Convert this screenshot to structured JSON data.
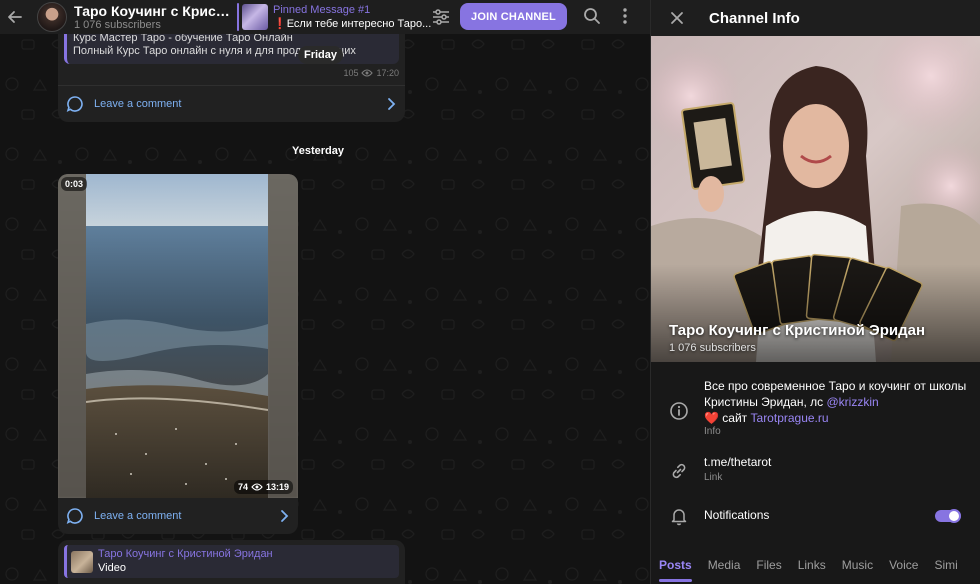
{
  "header": {
    "back_label": "←",
    "channel_title": "Таро Коучинг с Кристи...",
    "subscribers": "1 076 subscribers",
    "pinned_title": "Pinned Message #1",
    "pinned_text": "Если тебе интересно Таро...",
    "pinned_mark": "❗",
    "join_label": "JOIN CHANNEL"
  },
  "messages": {
    "msg1": {
      "reply_line1": "Курс Мастер Таро - обучение Таро Онлайн",
      "reply_line2": "Полный Курс Таро онлайн с нуля и для продолжающих",
      "views": "105",
      "time": "17:20",
      "comment_label": "Leave a comment"
    },
    "day_chip": "Friday",
    "date_separator": "Yesterday",
    "msg2": {
      "duration": "0:03",
      "views": "74",
      "time": "13:19",
      "comment_label": "Leave a comment"
    },
    "msg3": {
      "quote_name": "Таро Коучинг с Кристиной Эридан",
      "quote_sub": "Video"
    }
  },
  "panel": {
    "close_label": "×",
    "title": "Channel Info",
    "channel_name": "Таро Коучинг с Кристиной Эридан",
    "subscribers": "1 076 subscribers",
    "about_text_1": "Все про современное Таро и коучинг от школы Кристины Эридан, лс",
    "about_handle": "@krizzkin",
    "about_heart": "❤️",
    "about_text_2": "сайт",
    "about_site": "Tarotprague.ru",
    "about_label": "Info",
    "link_value": "t.me/thetarot",
    "link_label": "Link",
    "notifications_label": "Notifications",
    "notifications_on": true
  },
  "tabs": [
    "Posts",
    "Media",
    "Files",
    "Links",
    "Music",
    "Voice",
    "Simi"
  ],
  "colors": {
    "accent": "#8774e1",
    "panel_bg": "#181818",
    "bubble_bg": "#212121"
  },
  "icons": [
    "arrow-left-icon",
    "filter-icon",
    "search-icon",
    "more-vertical-icon",
    "eye-icon",
    "comment-icon",
    "chevron-right-icon",
    "close-icon",
    "info-icon",
    "link-icon",
    "bell-icon"
  ]
}
